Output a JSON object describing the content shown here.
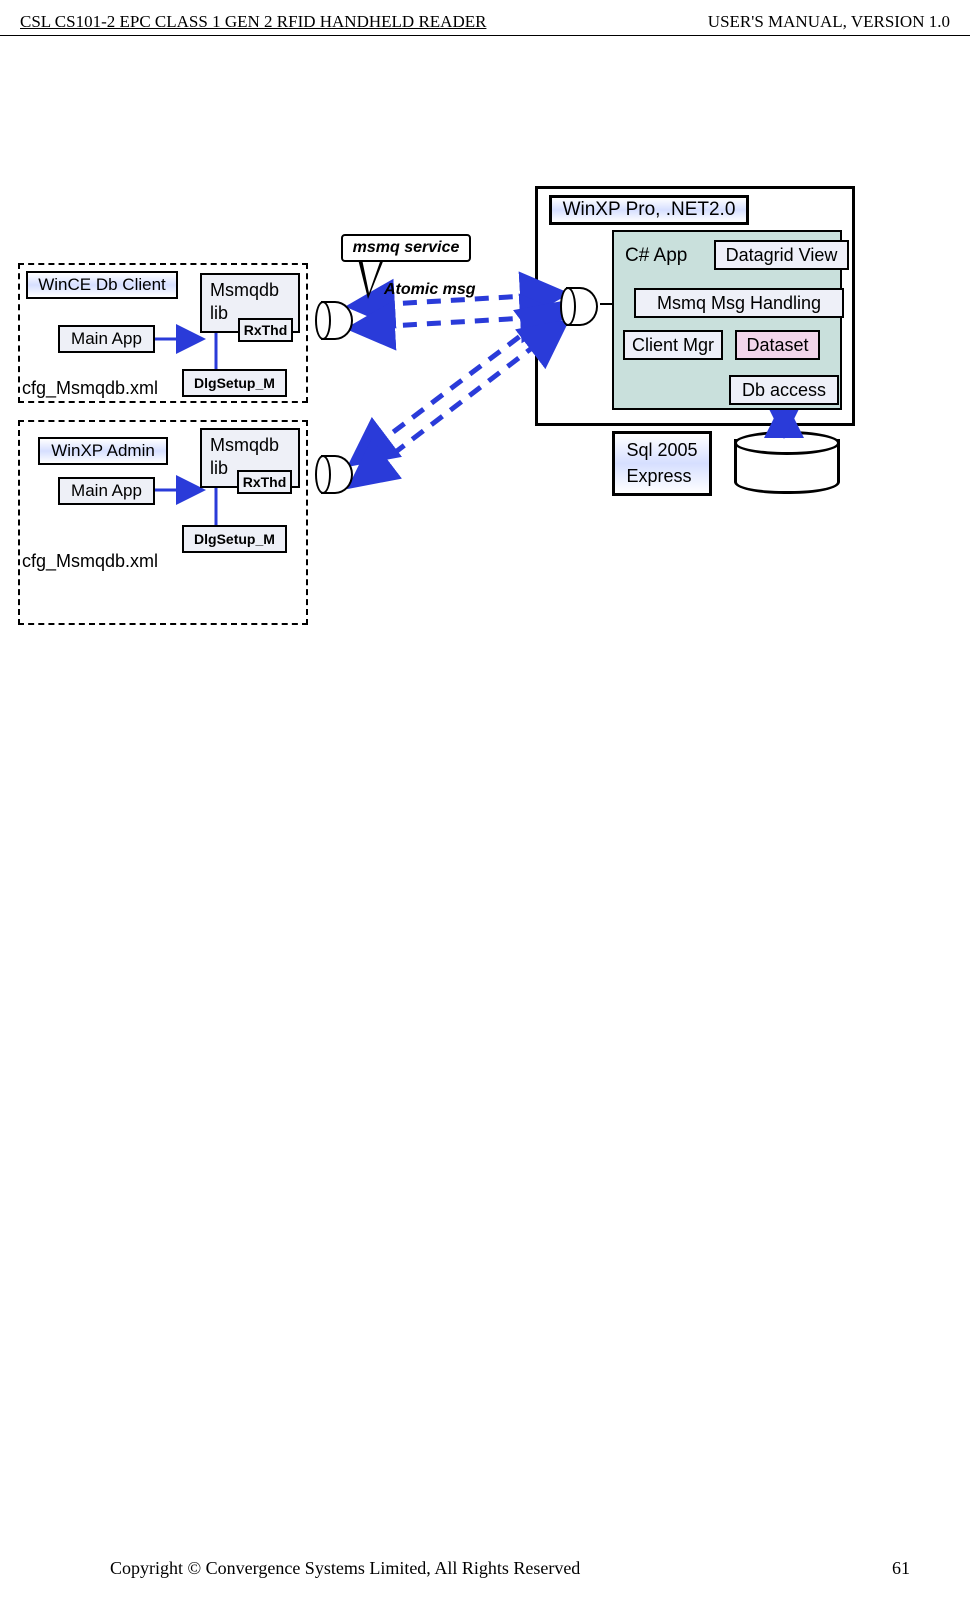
{
  "header": {
    "left": "CSL CS101-2 EPC CLASS 1 GEN 2 RFID HANDHELD READER",
    "right": "USER'S   MANUAL,   VERSION  1.0"
  },
  "server": {
    "title": "WinXP Pro, .NET2.0",
    "app_label": "C# App",
    "datagrid": "Datagrid View",
    "msmq_handling": "Msmq Msg Handling",
    "client_mgr": "Client Mgr",
    "dataset": "Dataset",
    "db_access": "Db access",
    "sql": "Sql 2005\nExpress"
  },
  "client1": {
    "title": "WinCE Db Client",
    "main_app": "Main App",
    "msmqdb": "Msmqdb lib",
    "rxthd": "RxThd",
    "dlgsetup": "DlgSetup_M",
    "cfg": "cfg_Msmqdb.xml"
  },
  "client2": {
    "title": "WinXP Admin",
    "main_app": "Main App",
    "msmqdb": "Msmqdb lib",
    "rxthd": "RxThd",
    "dlgsetup": "DlgSetup_M",
    "cfg": "cfg_Msmqdb.xml"
  },
  "callout": "msmq service",
  "atomic_msg": "Atomic msg",
  "footer": {
    "copyright": "Copyright © Convergence Systems Limited, All Rights Reserved",
    "page": "61"
  }
}
